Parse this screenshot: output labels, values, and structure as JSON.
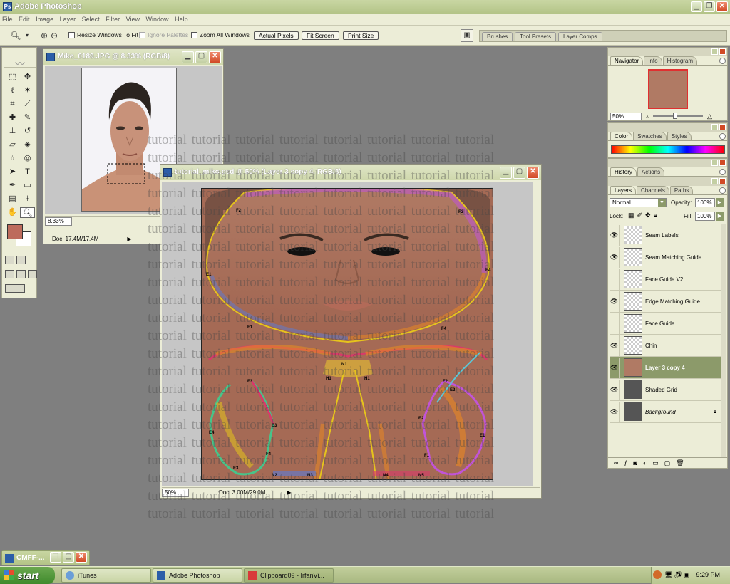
{
  "app": {
    "title": "Adobe Photoshop"
  },
  "menu": [
    "File",
    "Edit",
    "Image",
    "Layer",
    "Select",
    "Filter",
    "View",
    "Window",
    "Help"
  ],
  "options": {
    "resize_windows": "Resize Windows To Fit",
    "ignore_palettes": "Ignore Palettes",
    "zoom_all": "Zoom All Windows",
    "actual_pixels": "Actual Pixels",
    "fit_screen": "Fit Screen",
    "print_size": "Print Size"
  },
  "palette_well": {
    "tabs": [
      "Brushes",
      "Tool Presets",
      "Layer Comps"
    ]
  },
  "doc1": {
    "title": "Miko_0189.JPG @ 8.33% (RGB/8)",
    "zoom": "8.33%",
    "doc": "Doc: 17.4M/17.4M"
  },
  "doc2": {
    "title": "tutorial_miko.psd @ 50% (Layer 3 copy 4, RGB/8)",
    "zoom": "50%",
    "doc": "Doc: 3.00M/29.0M"
  },
  "seam_labels": [
    "F2",
    "F3",
    "E1",
    "E4",
    "F1",
    "F4",
    "N1",
    "H1",
    "H1",
    "F3",
    "F2",
    "E3",
    "E2",
    "E2",
    "E4",
    "F4",
    "F1",
    "E1",
    "E3",
    "N2",
    "N3",
    "N4",
    "N5"
  ],
  "watermark_word": "tutorial",
  "navigator": {
    "tabs": [
      "Navigator",
      "Info",
      "Histogram"
    ],
    "zoom": "50%"
  },
  "color": {
    "tabs": [
      "Color",
      "Swatches",
      "Styles"
    ]
  },
  "history": {
    "tabs": [
      "History",
      "Actions"
    ]
  },
  "layers": {
    "tabs": [
      "Layers",
      "Channels",
      "Paths"
    ],
    "blend_mode": "Normal",
    "opacity_label": "Opacity:",
    "opacity": "100%",
    "lock_label": "Lock:",
    "fill_label": "Fill:",
    "fill": "100%",
    "items": [
      {
        "name": "Seam Labels",
        "visible": true
      },
      {
        "name": "Seam Matching Guide",
        "visible": true
      },
      {
        "name": "Face Guide V2",
        "visible": false
      },
      {
        "name": "Edge Matching Guide",
        "visible": true
      },
      {
        "name": "Face Guide",
        "visible": false
      },
      {
        "name": "Chin",
        "visible": true
      },
      {
        "name": "Layer 3 copy 4",
        "visible": true,
        "selected": true
      },
      {
        "name": "Shaded Grid",
        "visible": true
      },
      {
        "name": "Background",
        "visible": true,
        "locked": true
      }
    ]
  },
  "taskbar": {
    "start": "start",
    "minimized": "CMFF-...",
    "items": [
      "iTunes",
      "Adobe Photoshop",
      "Clipboard09 - IrfanVi..."
    ],
    "clock": "9:29 PM"
  },
  "colors": {
    "foreground": "#bd6b5c",
    "background": "#ffffff",
    "selected_layer": "#8c9a6a"
  }
}
